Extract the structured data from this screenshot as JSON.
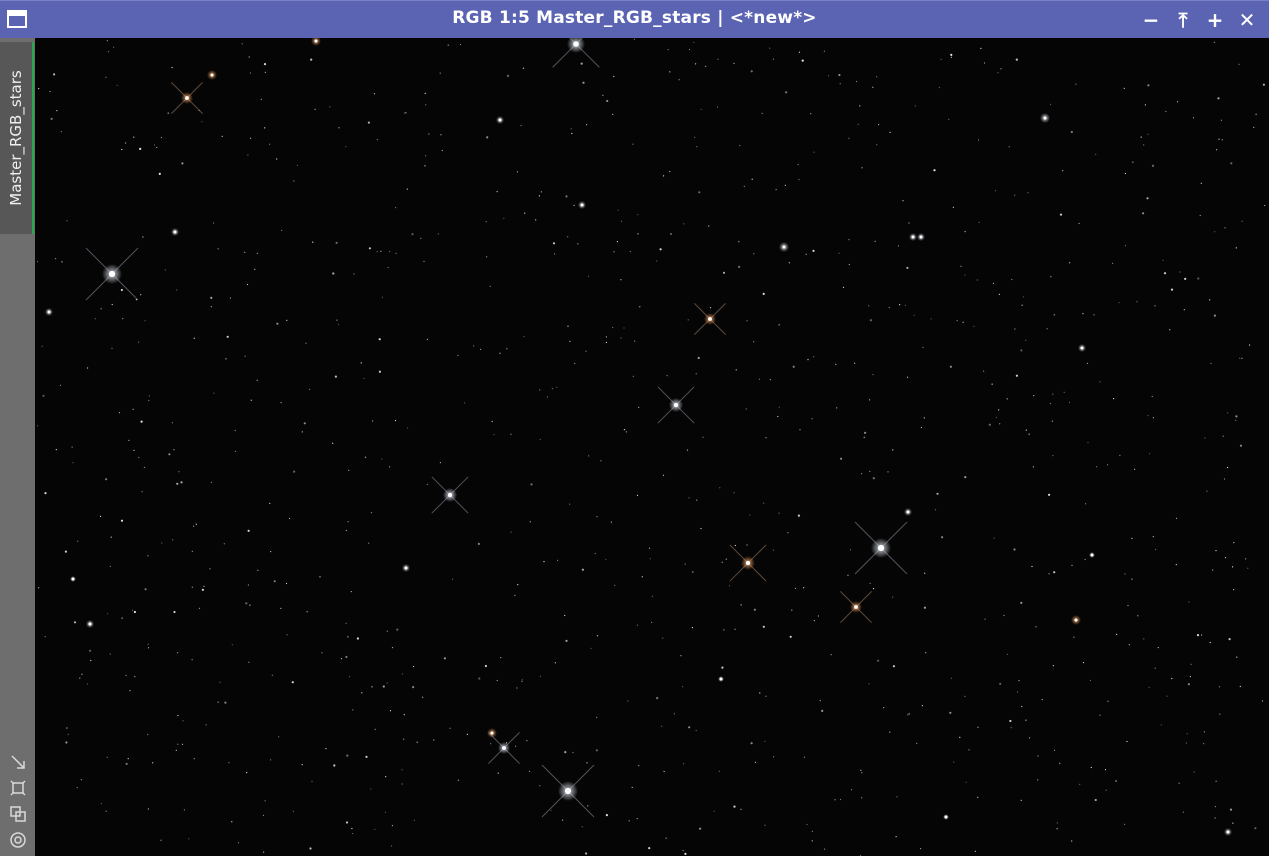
{
  "window": {
    "title": "RGB 1:5 Master_RGB_stars | <*new*>",
    "controls": [
      {
        "name": "minimize",
        "glyph": "−"
      },
      {
        "name": "shade",
        "glyph": "⤒"
      },
      {
        "name": "maximize",
        "glyph": "+"
      },
      {
        "name": "close",
        "glyph": "✕"
      }
    ]
  },
  "sidebar": {
    "tab_label": "Master_RGB_stars",
    "icons": [
      "expand-icon",
      "fit-icon",
      "clone-icon",
      "target-icon"
    ]
  },
  "colors": {
    "title_bar": "#5b63b3",
    "sidebar": "#6e6e6e",
    "tab_accent": "#27a84a",
    "background": "#050505"
  }
}
